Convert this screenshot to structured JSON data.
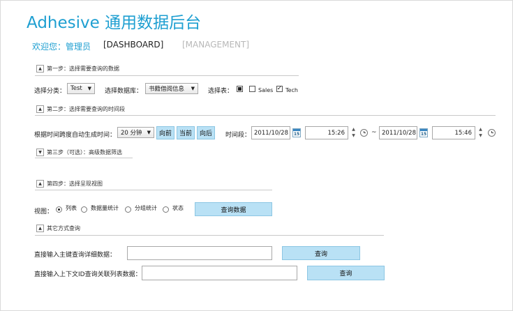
{
  "header": {
    "title": "Adhesive 通用数据后台"
  },
  "nav": {
    "user": "欢迎您：管理员",
    "dashboard": "[DASHBOARD]",
    "management": "[MANAGEMENT]"
  },
  "step1": {
    "title": "第一步：选择需要查询的数据",
    "category_label": "选择分类：",
    "category_value": "Test",
    "db_label": "选择数据库：",
    "db_value": "书籍借阅信息",
    "table_label": "选择表：",
    "tables": [
      {
        "label": "",
        "checked": false,
        "square": true
      },
      {
        "label": "Sales",
        "checked": false
      },
      {
        "label": "Tech",
        "checked": true
      }
    ]
  },
  "step2": {
    "title": "第二步：选择需要查询的时间段",
    "span_label": "根据时间跨度自动生成时间：",
    "span_value": "20 分钟",
    "btn_prev": "向前",
    "btn_now": "当前",
    "btn_next": "向后",
    "range_label": "时间段：",
    "start_date": "2011/10/28",
    "start_time": "15:26",
    "tilde": "~",
    "end_date": "2011/10/28",
    "end_time": "15:46",
    "cal_day": "15"
  },
  "step3": {
    "title": "第三步（可选）：高级数据筛选"
  },
  "step4": {
    "title": "第四步：选择呈现视图",
    "view_label": "视图：",
    "options": [
      "列表",
      "数据量统计",
      "分组统计",
      "状态"
    ],
    "selected": "列表",
    "query_btn": "查询数据"
  },
  "other": {
    "title": "其它方式查询",
    "pk_label": "直接输入主键查询详细数据：",
    "pk_btn": "查询",
    "ctx_label": "直接输入上下文ID查询关联列表数据：",
    "ctx_btn": "查询"
  }
}
